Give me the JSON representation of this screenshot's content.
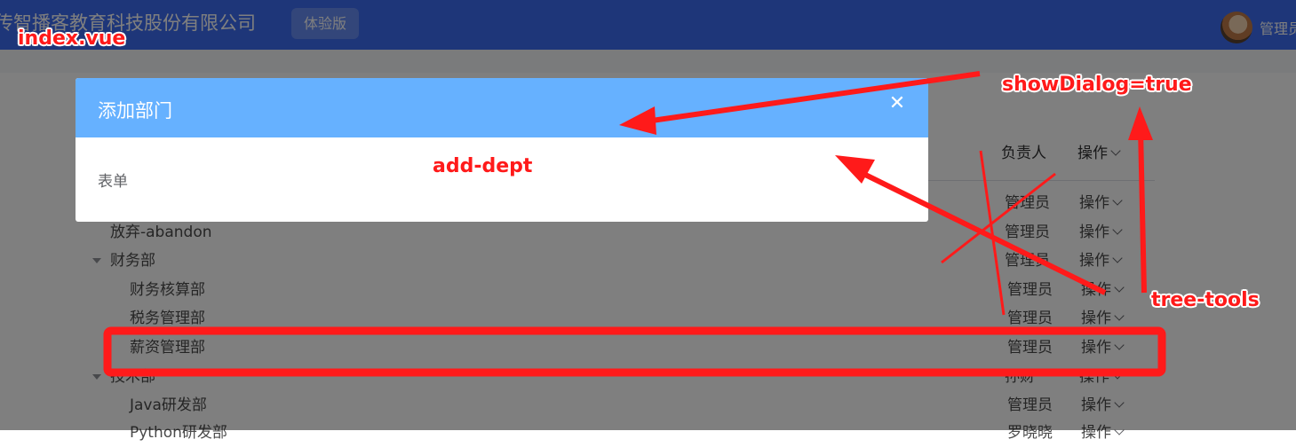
{
  "header": {
    "brand": "传智播客教育科技股份有限公司",
    "badge": "体验版",
    "username": "管理员"
  },
  "table": {
    "columns": {
      "owner": "负责人",
      "actions": "操作"
    },
    "rows": [
      {
        "name": "",
        "owner": "管理员",
        "action": "操作"
      },
      {
        "name": "放弃-abandon",
        "owner": "管理员",
        "action": "操作"
      },
      {
        "name": "财务部",
        "owner": "管理员",
        "action": "操作"
      },
      {
        "name": "财务核算部",
        "owner": "管理员",
        "action": "操作"
      },
      {
        "name": "税务管理部",
        "owner": "管理员",
        "action": "操作"
      },
      {
        "name": "薪资管理部",
        "owner": "管理员",
        "action": "操作"
      },
      {
        "name": "技术部",
        "owner": "孙财",
        "action": "操作"
      },
      {
        "name": "Java研发部",
        "owner": "管理员",
        "action": "操作"
      },
      {
        "name": "Python研发部",
        "owner": "罗晓晓",
        "action": "操作"
      }
    ]
  },
  "dialog": {
    "title": "添加部门",
    "close_icon": "close-icon",
    "body_text": "表单"
  },
  "annotations": {
    "index_label": "index.vue",
    "add_dept_label": "add-dept",
    "show_dialog_label": "showDialog=true",
    "tree_tools_label": "tree-tools",
    "color": "#ff1a1a"
  },
  "colors": {
    "navbar": "#3d6df2",
    "dialog_header": "#66b1ff",
    "mask": "rgba(0,0,0,0.5)"
  }
}
